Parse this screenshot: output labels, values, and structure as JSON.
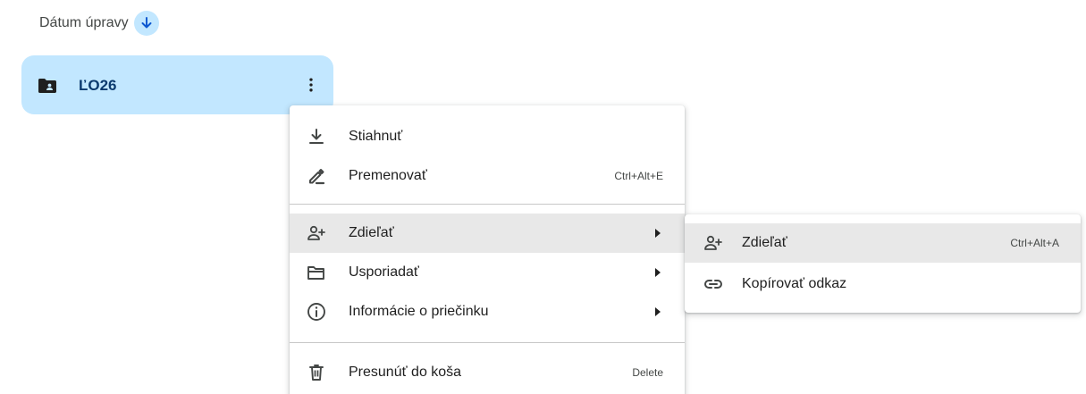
{
  "sort": {
    "label": "Dátum úpravy",
    "direction_icon": "arrow-down-icon"
  },
  "folder": {
    "name": "ĽO26",
    "icon": "shared-folder-icon",
    "more_icon": "more-vert-icon"
  },
  "context_menu": {
    "items": [
      {
        "label": "Stiahnuť",
        "icon": "download-icon",
        "shortcut": ""
      },
      {
        "label": "Premenovať",
        "icon": "rename-icon",
        "shortcut": "Ctrl+Alt+E"
      },
      {
        "label": "Zdieľať",
        "icon": "person-add-icon",
        "shortcut": "",
        "submenu": true
      },
      {
        "label": "Usporiadať",
        "icon": "folder-open-icon",
        "shortcut": "",
        "submenu": true
      },
      {
        "label": "Informácie o priečinku",
        "icon": "info-icon",
        "shortcut": "",
        "submenu": true
      },
      {
        "label": "Presunúť do koša",
        "icon": "trash-icon",
        "shortcut": "Delete"
      }
    ]
  },
  "share_submenu": {
    "items": [
      {
        "label": "Zdieľať",
        "icon": "person-add-icon",
        "shortcut": "Ctrl+Alt+A"
      },
      {
        "label": "Kopírovať odkaz",
        "icon": "link-icon",
        "shortcut": ""
      }
    ]
  },
  "colors": {
    "selected_background": "#c2e7ff",
    "folder_text": "#0b3a6e",
    "hover_background": "#e8e8e8"
  }
}
